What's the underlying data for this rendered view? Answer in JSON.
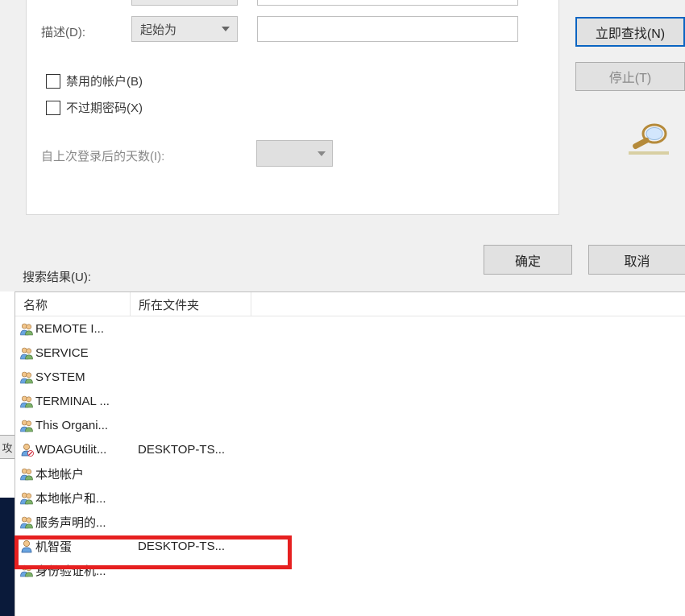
{
  "form": {
    "description_label": "描述(D):",
    "description_mode": "起始为",
    "checkbox_disabled": "禁用的帐户(B)",
    "checkbox_noexpiry": "不过期密码(X)",
    "days_label": "自上次登录后的天数(I):"
  },
  "actions": {
    "find_now": "立即查找(N)",
    "stop": "停止(T)",
    "ok": "确定",
    "cancel": "取消"
  },
  "results": {
    "label": "搜索结果(U):",
    "columns": {
      "name": "名称",
      "folder": "所在文件夹"
    },
    "rows": [
      {
        "icon": "group",
        "name": "REMOTE I...",
        "folder": ""
      },
      {
        "icon": "group",
        "name": "SERVICE",
        "folder": ""
      },
      {
        "icon": "group",
        "name": "SYSTEM",
        "folder": ""
      },
      {
        "icon": "group",
        "name": "TERMINAL ...",
        "folder": ""
      },
      {
        "icon": "group",
        "name": "This Organi...",
        "folder": ""
      },
      {
        "icon": "user-disabled",
        "name": "WDAGUtilit...",
        "folder": "DESKTOP-TS..."
      },
      {
        "icon": "group",
        "name": "本地帐户",
        "folder": ""
      },
      {
        "icon": "group",
        "name": "本地帐户和...",
        "folder": ""
      },
      {
        "icon": "group",
        "name": "服务声明的...",
        "folder": ""
      },
      {
        "icon": "user",
        "name": "机智蛋",
        "folder": "DESKTOP-TS..."
      },
      {
        "icon": "group",
        "name": "身份验证机...",
        "folder": ""
      }
    ]
  },
  "behind_char": "攻"
}
